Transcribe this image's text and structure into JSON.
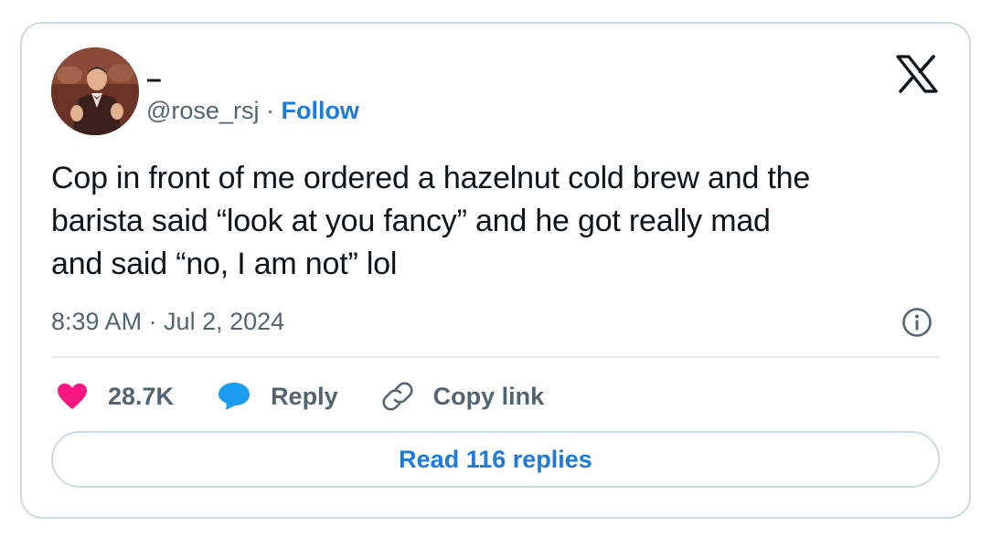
{
  "author": {
    "display_name": "–",
    "handle": "@rose_rsj",
    "separator": " · ",
    "follow_label": "Follow"
  },
  "tweet": {
    "lines": [
      "Cop in front of me ordered a hazelnut cold brew and the",
      "barista said “look at you fancy” and he got really mad",
      "and said “no, I am not” lol"
    ],
    "timestamp": "8:39 AM · Jul 2, 2024"
  },
  "actions": {
    "like_count": "28.7K",
    "reply_label": "Reply",
    "copy_link_label": "Copy link"
  },
  "read_replies_label": "Read 116 replies",
  "icons": {
    "logo": "x-logo-icon",
    "info": "info-icon",
    "like": "heart-icon",
    "reply": "speech-bubble-icon",
    "copy": "link-icon"
  },
  "colors": {
    "like": "#f91880",
    "reply": "#1d9bf0",
    "link": "#1d7bd9",
    "muted": "#536471",
    "border": "#cfd9de"
  }
}
